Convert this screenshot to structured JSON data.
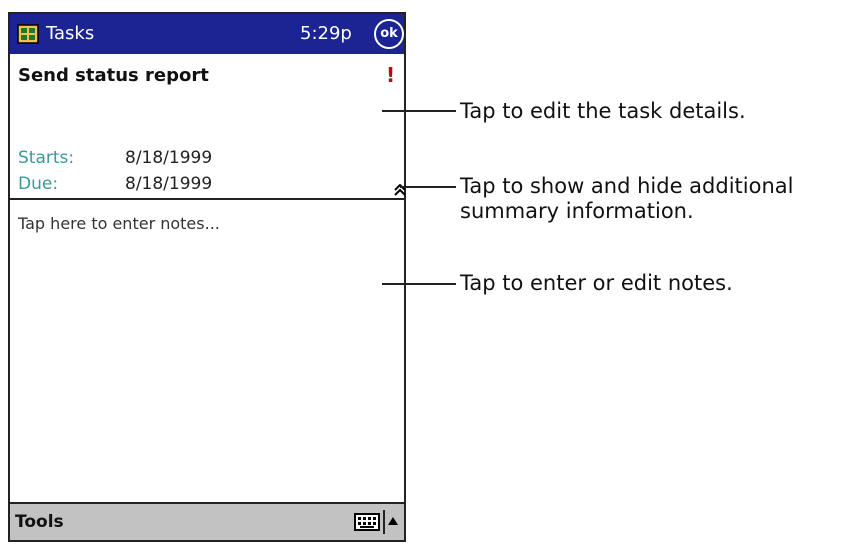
{
  "titlebar": {
    "app_name": "Tasks",
    "time": "5:29p",
    "ok_label": "ok",
    "app_icon": "tasks-app-icon",
    "bg_color": "#1c2494"
  },
  "task": {
    "title": "Send status report",
    "priority_mark": "!",
    "starts_label": "Starts:",
    "starts_value": "8/18/1999",
    "due_label": "Due:",
    "due_value": "8/18/1999"
  },
  "notes": {
    "placeholder": "Tap here to enter notes..."
  },
  "toolbar": {
    "tools_label": "Tools",
    "keyboard_icon": "keyboard-icon",
    "sip_icon": "up-arrow-icon"
  },
  "callouts": [
    {
      "text": "Tap to edit the task details."
    },
    {
      "line1": "Tap to show and hide additional",
      "line2": "summary information."
    },
    {
      "text": "Tap to enter or edit notes."
    }
  ]
}
